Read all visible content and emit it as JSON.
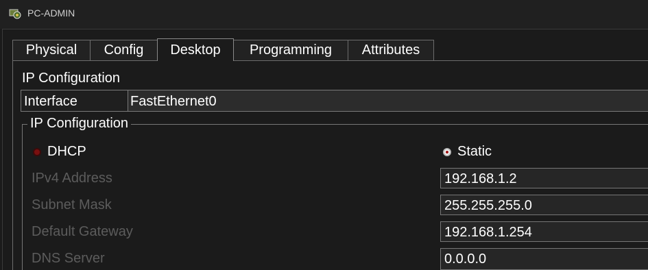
{
  "window": {
    "title": "PC-ADMIN"
  },
  "tabs": [
    {
      "label": "Physical"
    },
    {
      "label": "Config"
    },
    {
      "label": "Desktop"
    },
    {
      "label": "Programming"
    },
    {
      "label": "Attributes"
    }
  ],
  "active_tab": "Desktop",
  "section": {
    "title": "IP Configuration"
  },
  "interface": {
    "label": "Interface",
    "value": "FastEthernet0"
  },
  "ip_config": {
    "legend": "IP Configuration",
    "dhcp_label": "DHCP",
    "static_label": "Static",
    "selected_mode": "Static",
    "fields": [
      {
        "label": "IPv4 Address",
        "value": "192.168.1.2"
      },
      {
        "label": "Subnet Mask",
        "value": "255.255.255.0"
      },
      {
        "label": "Default Gateway",
        "value": "192.168.1.254"
      },
      {
        "label": "DNS Server",
        "value": "0.0.0.0"
      }
    ]
  },
  "colors": {
    "background": "#1b1b1b",
    "disabled_label": "#5c5c5c",
    "radio_selected_dot": "#a01414"
  },
  "icons": {
    "app": "cisco-pc-icon"
  }
}
